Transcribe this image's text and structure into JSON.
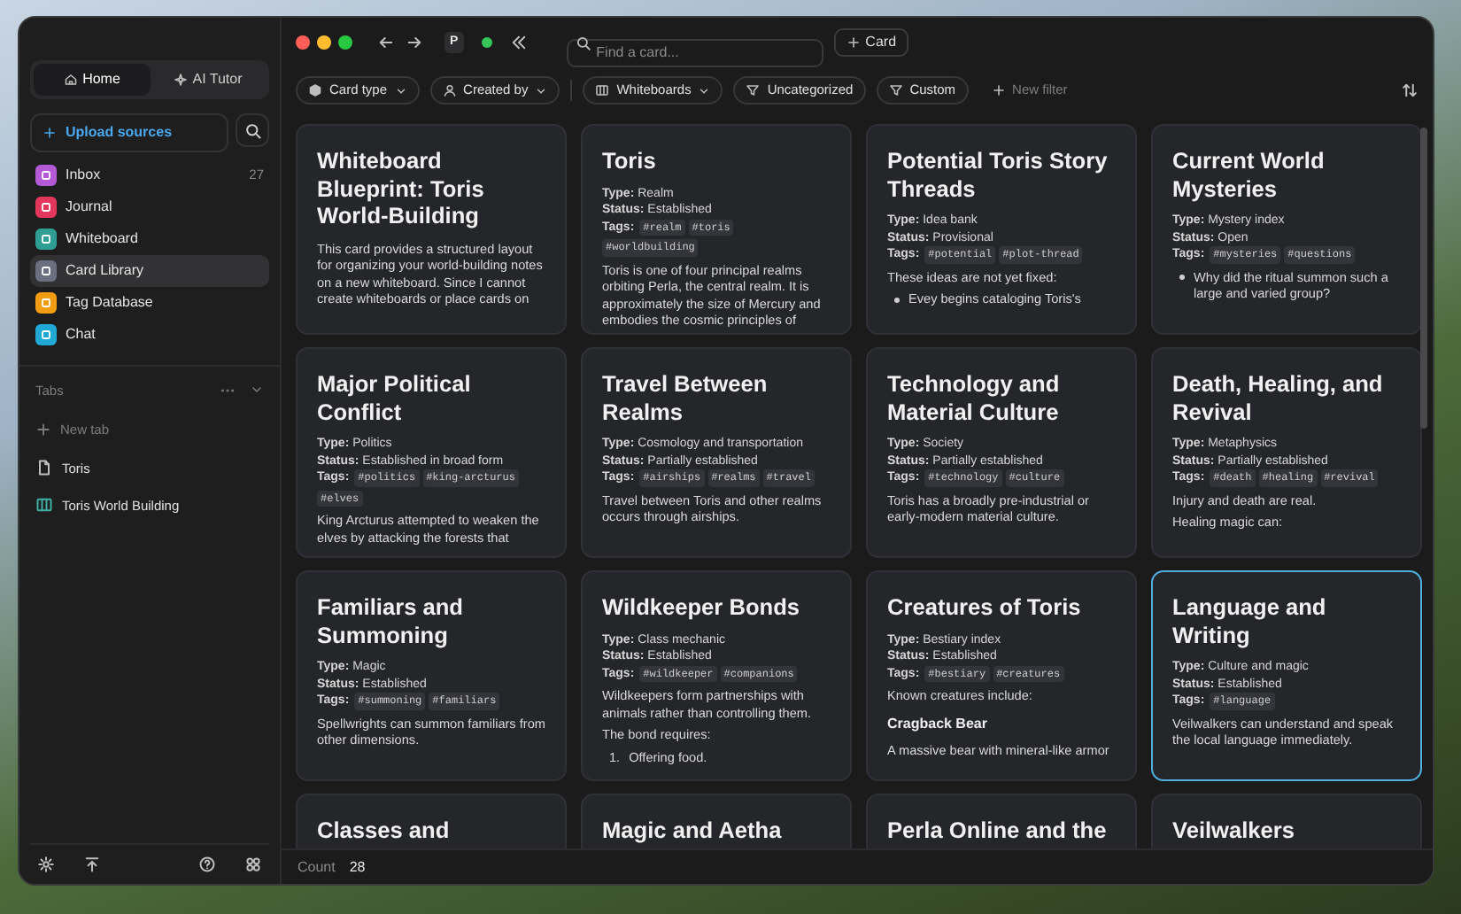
{
  "topbar": {
    "avatar": "P",
    "search": {
      "placeholder": "Find a card..."
    },
    "new_card": "Card"
  },
  "sidebar": {
    "modes": [
      {
        "label": "Home",
        "selected": true,
        "kind": "home"
      },
      {
        "label": "AI Tutor",
        "selected": false,
        "kind": "tutor"
      }
    ],
    "upload": "Upload sources",
    "items": [
      {
        "label": "Inbox",
        "color": "#b45ad6",
        "count": "27",
        "selected": false
      },
      {
        "label": "Journal",
        "color": "#e2365c",
        "selected": false
      },
      {
        "label": "Whiteboard",
        "color": "#2f9e95",
        "selected": false
      },
      {
        "label": "Card Library",
        "color": "#6b7080",
        "selected": true
      },
      {
        "label": "Tag Database",
        "color": "#f29d12",
        "selected": false
      },
      {
        "label": "Chat",
        "color": "#21a9d6",
        "selected": false
      }
    ],
    "tabs_heading": "Tabs",
    "new_tab": "New tab",
    "tabs": [
      {
        "label": "Toris",
        "kind": "doc"
      },
      {
        "label": "Toris World Building",
        "kind": "whiteboard"
      }
    ]
  },
  "filters": [
    {
      "label": "Card type",
      "kind": "type"
    },
    {
      "label": "Created by",
      "kind": "person"
    },
    {
      "label": "Whiteboards",
      "kind": "board"
    },
    {
      "label": "Uncategorized",
      "kind": "filter"
    },
    {
      "label": "Custom",
      "kind": "filter"
    },
    {
      "label": "New filter",
      "kind": "add"
    }
  ],
  "cards": [
    {
      "title": "Whiteboard Blueprint: Toris World-Building",
      "selected": false,
      "body": [
        {
          "kind": "p",
          "text": "This card provides a structured layout for organizing your world-building notes on a new whiteboard. Since I cannot create whiteboards or place cards on"
        }
      ]
    },
    {
      "title": "Toris",
      "selected": false,
      "meta": [
        "**Type:** Realm",
        "**Status:** Established"
      ],
      "tags_label": "Tags:",
      "tags": [
        "#realm",
        "#toris",
        "#worldbuilding"
      ],
      "body": [
        {
          "kind": "p",
          "text": "Toris is one of four principal realms orbiting Perla, the central realm. It is approximately the size of Mercury and embodies the cosmic principles of"
        }
      ]
    },
    {
      "title": "Potential Toris Story Threads",
      "selected": false,
      "meta": [
        "**Type:** Idea bank",
        "**Status:** Provisional"
      ],
      "tags_label": "Tags:",
      "tags": [
        "#potential",
        "#plot-thread"
      ],
      "body": [
        {
          "kind": "p",
          "text": "These ideas are not yet fixed:"
        },
        {
          "kind": "bullet",
          "text": "Evey begins cataloging Toris's"
        }
      ]
    },
    {
      "title": "Current World Mysteries",
      "selected": false,
      "meta": [
        "**Type:** Mystery index",
        "**Status:** Open"
      ],
      "tags_label": "Tags:",
      "tags": [
        "#mysteries",
        "#questions"
      ],
      "body": [
        {
          "kind": "bullet",
          "text": "Why did the ritual summon such a large and varied group?"
        }
      ]
    },
    {
      "title": "Major Political Conflict",
      "selected": false,
      "meta": [
        "**Type:** Politics",
        "**Status:** Established in broad form"
      ],
      "tags_label": "Tags:",
      "tags": [
        "#politics",
        "#king-arcturus",
        "#elves"
      ],
      "body": [
        {
          "kind": "p",
          "text": "King Arcturus attempted to weaken the elves by attacking the forests that"
        }
      ]
    },
    {
      "title": "Travel Between Realms",
      "selected": false,
      "meta": [
        "**Type:** Cosmology and transportation",
        "**Status:** Partially established"
      ],
      "tags_label": "Tags:",
      "tags": [
        "#airships",
        "#realms",
        "#travel"
      ],
      "body": [
        {
          "kind": "p",
          "text": "Travel between Toris and other realms occurs through airships."
        }
      ]
    },
    {
      "title": "Technology and Material Culture",
      "selected": false,
      "meta": [
        "**Type:** Society",
        "**Status:** Partially established"
      ],
      "tags_label": "Tags:",
      "tags": [
        "#technology",
        "#culture"
      ],
      "body": [
        {
          "kind": "p",
          "text": "Toris has a broadly pre-industrial or early-modern material culture."
        }
      ]
    },
    {
      "title": "Death, Healing, and Revival",
      "selected": false,
      "meta": [
        "**Type:** Metaphysics",
        "**Status:** Partially established"
      ],
      "tags_label": "Tags:",
      "tags": [
        "#death",
        "#healing",
        "#revival"
      ],
      "body": [
        {
          "kind": "p",
          "text": "Injury and death are real."
        },
        {
          "kind": "p",
          "text": "Healing magic can:"
        }
      ]
    },
    {
      "title": "Familiars and Summoning",
      "selected": false,
      "meta": [
        "**Type:** Magic",
        "**Status:** Established"
      ],
      "tags_label": "Tags:",
      "tags": [
        "#summoning",
        "#familiars"
      ],
      "body": [
        {
          "kind": "p",
          "text": "Spellwrights can summon familiars from other dimensions."
        }
      ]
    },
    {
      "title": "Wildkeeper Bonds",
      "selected": false,
      "meta": [
        "**Type:** Class mechanic",
        "**Status:** Established"
      ],
      "tags_label": "Tags:",
      "tags": [
        "#wildkeeper",
        "#companions"
      ],
      "body": [
        {
          "kind": "p",
          "text": "Wildkeepers form partnerships with animals rather than controlling them."
        },
        {
          "kind": "p",
          "text": "The bond requires:"
        },
        {
          "kind": "numbered",
          "marker": "1.",
          "text": "Offering food."
        }
      ]
    },
    {
      "title": "Creatures of Toris",
      "selected": false,
      "meta": [
        "**Type:** Bestiary index",
        "**Status:** Established"
      ],
      "tags_label": "Tags:",
      "tags": [
        "#bestiary",
        "#creatures"
      ],
      "body": [
        {
          "kind": "p",
          "text": "Known creatures include:"
        },
        {
          "kind": "heading",
          "text": "Cragback Bear"
        },
        {
          "kind": "p",
          "text": "A massive bear with mineral-like armor"
        }
      ]
    },
    {
      "title": "Language and Writing",
      "selected": true,
      "meta": [
        "**Type:** Culture and magic",
        "**Status:** Established"
      ],
      "tags_label": "Tags:",
      "tags": [
        "#language"
      ],
      "body": [
        {
          "kind": "p",
          "text": "Veilwalkers can understand and speak the local language immediately."
        }
      ]
    },
    {
      "title": "Classes and",
      "selected": false
    },
    {
      "title": "Magic and Aetha",
      "selected": false
    },
    {
      "title": "Perla Online and the",
      "selected": false
    },
    {
      "title": "Veilwalkers",
      "selected": false
    }
  ],
  "footer": {
    "label": "Count",
    "value": "28"
  }
}
